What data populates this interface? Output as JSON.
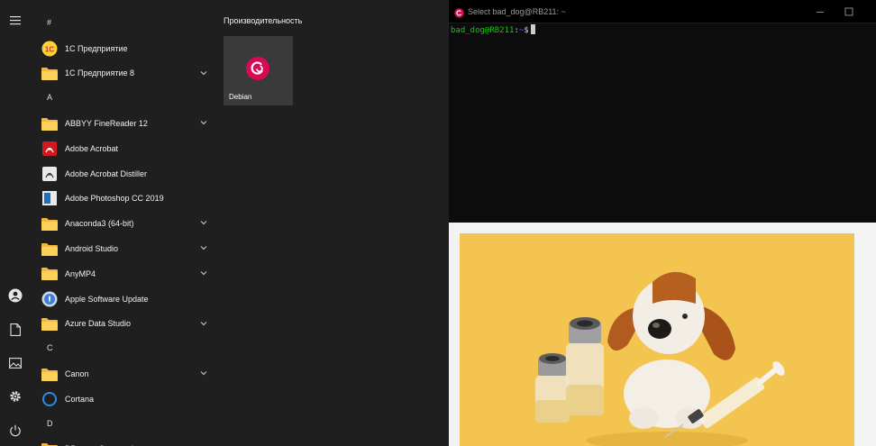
{
  "start_menu": {
    "rail_icons": [
      "hamburger-icon",
      "user-icon",
      "documents-icon",
      "pictures-icon",
      "settings-icon",
      "power-icon"
    ],
    "apps": [
      {
        "kind": "letter",
        "text": "#"
      },
      {
        "kind": "app",
        "label": "1С Предприятие",
        "icon": "1c-icon",
        "expand": false
      },
      {
        "kind": "app",
        "label": "1С Предприятие 8",
        "icon": "folder-icon",
        "expand": true
      },
      {
        "kind": "letter",
        "text": "A"
      },
      {
        "kind": "app",
        "label": "ABBYY FineReader 12",
        "icon": "folder-icon",
        "expand": true
      },
      {
        "kind": "app",
        "label": "Adobe Acrobat",
        "icon": "adobe-acrobat-icon",
        "expand": false
      },
      {
        "kind": "app",
        "label": "Adobe Acrobat Distiller",
        "icon": "acrobat-distiller-icon",
        "expand": false
      },
      {
        "kind": "app",
        "label": "Adobe Photoshop CC 2019",
        "icon": "photoshop-icon",
        "expand": false
      },
      {
        "kind": "app",
        "label": "Anaconda3 (64-bit)",
        "icon": "folder-icon",
        "expand": true
      },
      {
        "kind": "app",
        "label": "Android Studio",
        "icon": "folder-icon",
        "expand": true
      },
      {
        "kind": "app",
        "label": "AnyMP4",
        "icon": "folder-icon",
        "expand": true
      },
      {
        "kind": "app",
        "label": "Apple Software Update",
        "icon": "apple-update-icon",
        "expand": false
      },
      {
        "kind": "app",
        "label": "Azure Data Studio",
        "icon": "folder-icon",
        "expand": true
      },
      {
        "kind": "letter",
        "text": "C"
      },
      {
        "kind": "app",
        "label": "Canon",
        "icon": "folder-icon",
        "expand": true
      },
      {
        "kind": "app",
        "label": "Cortana",
        "icon": "cortana-icon",
        "expand": false
      },
      {
        "kind": "letter",
        "text": "D"
      },
      {
        "kind": "app",
        "label": "DBeaver Community",
        "icon": "folder-icon",
        "expand": true
      }
    ],
    "tiles_group_title": "Производительность",
    "tile": {
      "label": "Debian",
      "icon": "debian-icon"
    }
  },
  "terminal": {
    "title": "Select bad_dog@RB211: ~",
    "prompt_user": "bad_dog@RB211",
    "prompt_colon": ":",
    "prompt_path": "~",
    "prompt_symbol": "$",
    "colors": {
      "user": "#16c60c",
      "path": "#3b78ff",
      "background": "#0c0c0c"
    }
  },
  "photo": {
    "subject": "plush-dog-with-vials-and-syringe",
    "background_color": "#f3c44f"
  }
}
